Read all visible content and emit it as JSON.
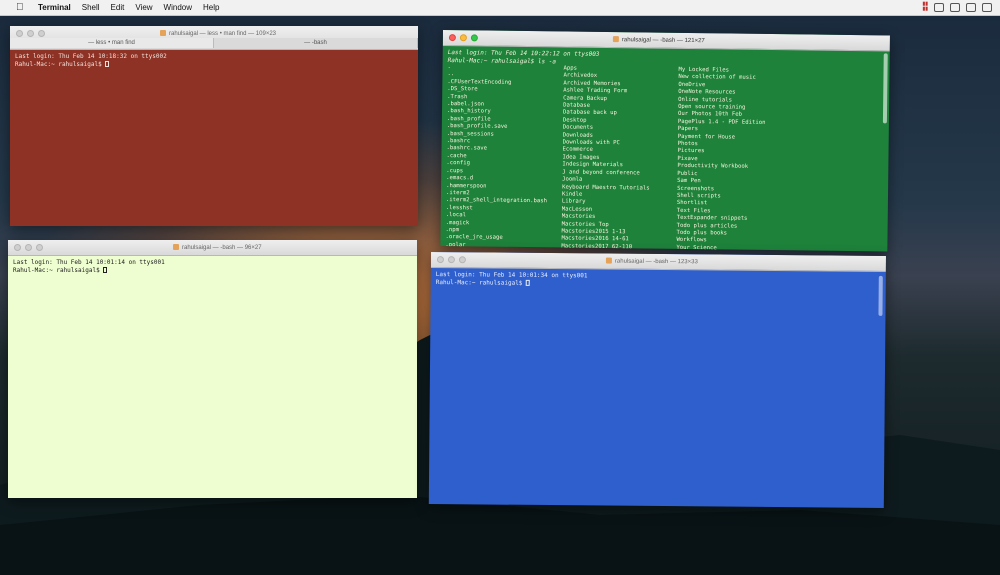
{
  "menubar": {
    "items": [
      "Terminal",
      "Shell",
      "Edit",
      "View",
      "Window",
      "Help"
    ]
  },
  "windows": {
    "red": {
      "title": "rahulsaigal — less • man find — 109×23",
      "tabs": [
        "— less • man find",
        "— -bash"
      ],
      "lines": [
        "Last login: Thu Feb 14 10:18:32 on ttys002",
        "Rahul-Mac:~ rahulsaigal$ "
      ]
    },
    "green": {
      "title": "rahulsaigal — -bash — 121×27",
      "lines": [
        "Last login: Thu Feb 14 10:22:12 on ttys003",
        "Rahul-Mac:~ rahulsaigal$ ls -a"
      ],
      "col1": [
        ".",
        "..",
        ".CFUserTextEncoding",
        ".DS_Store",
        ".Trash",
        ".babel.json",
        ".bash_history",
        ".bash_profile",
        ".bash_profile.save",
        ".bash_sessions",
        ".bashrc",
        ".bashrc.save",
        ".cache",
        ".config",
        ".cups",
        ".emacs.d",
        ".hammerspoon",
        ".iterm2",
        ".iterm2_shell_integration.bash",
        ".lesshst",
        ".local",
        ".magick",
        ".npm",
        ".oracle_jre_usage",
        ".polar"
      ],
      "col2": [
        "Apps",
        "Archivedox",
        "Archived Memories",
        "Ashlee Trading Form",
        "Camera Backup",
        "Database",
        "Database back up",
        "Desktop",
        "Documents",
        "Downloads",
        "Downloads with PC",
        "Ecommerce",
        "Idea Images",
        "Indesign Materials",
        "J and beyond conference",
        "Joomla",
        "Keyboard Maestro Tutorials",
        "Kindle",
        "Library",
        "MacLesson",
        "Macstories",
        "Macstories Top",
        "Macstories2015 1-13",
        "Macstories2016 14-61",
        "Macstories2017 62-110"
      ],
      "col3": [
        "My Locked Files",
        "New collection of music",
        "OneDrive",
        "OneNote Resources",
        "Online tutorials",
        "Open source training",
        "Our Photos 10th Feb",
        "PagePlus 1.4 - PDF Edition",
        "Papers",
        "Payment for House",
        "Photos",
        "Pictures",
        "Pixave",
        "Productivity Workbook",
        "Public",
        "Sam Pen",
        "Screenshots",
        "Shell scripts",
        "Shortlist",
        "Text Files",
        "TextExpander snippets",
        "Todo plus articles",
        "Todo plus books",
        "Workflows",
        "Your Science"
      ]
    },
    "yellow": {
      "title": "rahulsaigal — -bash — 96×27",
      "lines": [
        "Last login: Thu Feb 14 10:01:14 on ttys001",
        "Rahul-Mac:~ rahulsaigal$ "
      ]
    },
    "blue": {
      "title": "rahulsaigal — -bash — 123×33",
      "lines": [
        "Last login: Thu Feb 14 10:01:34 on ttys001",
        "Rahul-Mac:~ rahulsaigal$ "
      ]
    }
  }
}
